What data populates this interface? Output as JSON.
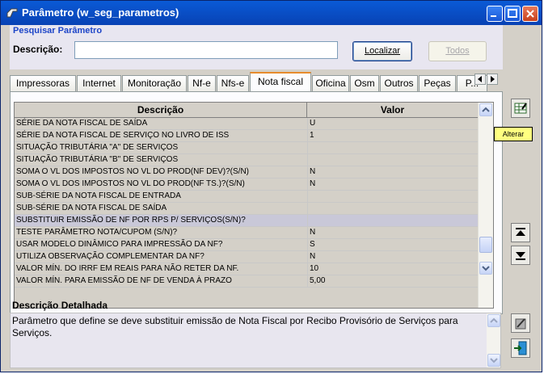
{
  "window": {
    "title": "Parâmetro (w_seg_parametros)",
    "controls": [
      "minimize-icon",
      "maximize-icon",
      "close-icon"
    ]
  },
  "search": {
    "section_title": "Pesquisar Parâmetro",
    "description_label": "Descrição:",
    "description_value": "",
    "localizar_label": "Localizar",
    "todos_label": "Todos"
  },
  "tabs": [
    "Impressoras",
    "Internet",
    "Monitoração",
    "Nf-e",
    "Nfs-e",
    "Nota fiscal",
    "Oficina",
    "Osm",
    "Outros",
    "Peças",
    "P..."
  ],
  "active_tab": "Nota fiscal",
  "grid": {
    "columns": [
      "Descrição",
      "Valor"
    ],
    "rows": [
      {
        "desc": "SÉRIE DA NOTA FISCAL DE SAÍDA",
        "val": "U"
      },
      {
        "desc": "SÉRIE DA NOTA FISCAL DE SERVIÇO NO LIVRO DE ISS",
        "val": "1"
      },
      {
        "desc": "SITUAÇÃO TRIBUTÁRIA \"A\" DE SERVIÇOS",
        "val": ""
      },
      {
        "desc": "SITUAÇÃO TRIBUTÁRIA \"B\" DE SERVIÇOS",
        "val": ""
      },
      {
        "desc": "SOMA O VL DOS IMPOSTOS NO VL DO PROD(NF DEV)?(S/N)",
        "val": "N"
      },
      {
        "desc": "SOMA O VL DOS IMPOSTOS NO VL DO PROD(NF TS.)?(S/N)",
        "val": "N"
      },
      {
        "desc": "SUB-SÉRIE DA NOTA FISCAL DE ENTRADA",
        "val": ""
      },
      {
        "desc": "SUB-SÉRIE DA NOTA FISCAL DE SAÍDA",
        "val": ""
      },
      {
        "desc": "SUBSTITUIR EMISSÃO DE NF POR RPS P/ SERVIÇOS(S/N)?",
        "val": ""
      },
      {
        "desc": "TESTE PARÂMETRO NOTA/CUPOM (S/N)?",
        "val": "N"
      },
      {
        "desc": "USAR MODELO DINÂMICO PARA IMPRESSÃO DA NF?",
        "val": "S"
      },
      {
        "desc": "UTILIZA OBSERVAÇÃO COMPLEMENTAR DA NF?",
        "val": "N"
      },
      {
        "desc": "VALOR MÍN. DO IRRF EM REAIS PARA NÃO RETER DA NF.",
        "val": "10"
      },
      {
        "desc": "VALOR MÍN. PARA EMISSÃO DE NF DE VENDA À PRAZO",
        "val": "5,00"
      }
    ],
    "selected_index": 8
  },
  "detail": {
    "title": "Descrição Detalhada",
    "text": "Parâmetro que define se deve substituir emissão de Nota Fiscal por Recibo Provisório de Serviços para Serviços."
  },
  "tooltip": "Alterar",
  "colors": {
    "title_bar": "#0842b4",
    "section_title": "#1d45c8",
    "active_tab_accent": "#e68b2c",
    "selected_row": "#c9c8d8",
    "tooltip_bg": "#ffff80"
  }
}
